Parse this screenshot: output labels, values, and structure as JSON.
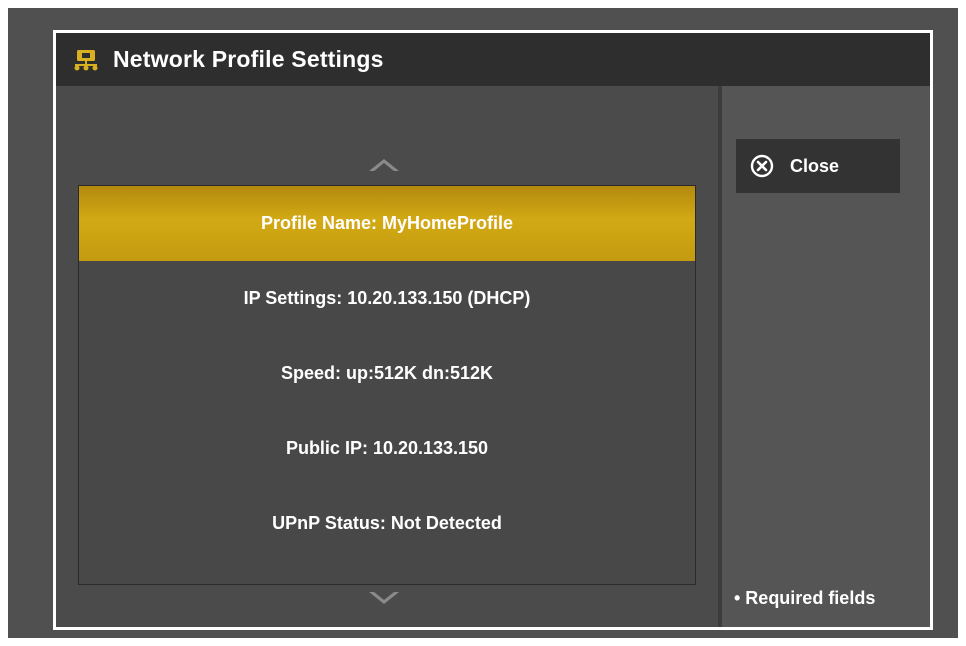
{
  "dialog": {
    "title": "Network Profile Settings",
    "icon": "network-profile-icon",
    "accent_color": "#d2a914"
  },
  "list": {
    "scroll_up_icon": "chevron-up-icon",
    "scroll_down_icon": "chevron-down-icon",
    "items": [
      {
        "label": "Profile Name: MyHomeProfile",
        "selected": true
      },
      {
        "label": "IP Settings: 10.20.133.150 (DHCP)",
        "selected": false
      },
      {
        "label": "Speed: up:512K dn:512K",
        "selected": false
      },
      {
        "label": "Public IP: 10.20.133.150",
        "selected": false
      },
      {
        "label": "UPnP Status: Not Detected",
        "selected": false
      }
    ]
  },
  "side": {
    "close_label": "Close",
    "close_icon": "close-circle-icon",
    "required_note": "• Required fields"
  }
}
